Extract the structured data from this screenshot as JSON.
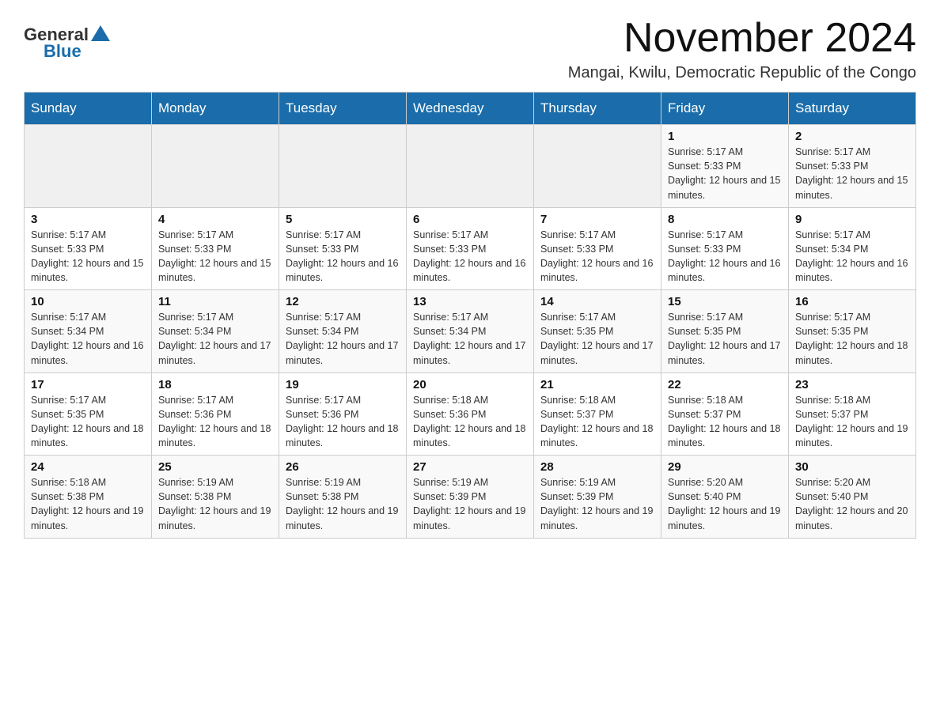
{
  "header": {
    "logo_general": "General",
    "logo_blue": "Blue",
    "title": "November 2024",
    "subtitle": "Mangai, Kwilu, Democratic Republic of the Congo"
  },
  "days_of_week": [
    "Sunday",
    "Monday",
    "Tuesday",
    "Wednesday",
    "Thursday",
    "Friday",
    "Saturday"
  ],
  "weeks": [
    [
      {
        "day": "",
        "info": ""
      },
      {
        "day": "",
        "info": ""
      },
      {
        "day": "",
        "info": ""
      },
      {
        "day": "",
        "info": ""
      },
      {
        "day": "",
        "info": ""
      },
      {
        "day": "1",
        "info": "Sunrise: 5:17 AM\nSunset: 5:33 PM\nDaylight: 12 hours and 15 minutes."
      },
      {
        "day": "2",
        "info": "Sunrise: 5:17 AM\nSunset: 5:33 PM\nDaylight: 12 hours and 15 minutes."
      }
    ],
    [
      {
        "day": "3",
        "info": "Sunrise: 5:17 AM\nSunset: 5:33 PM\nDaylight: 12 hours and 15 minutes."
      },
      {
        "day": "4",
        "info": "Sunrise: 5:17 AM\nSunset: 5:33 PM\nDaylight: 12 hours and 15 minutes."
      },
      {
        "day": "5",
        "info": "Sunrise: 5:17 AM\nSunset: 5:33 PM\nDaylight: 12 hours and 16 minutes."
      },
      {
        "day": "6",
        "info": "Sunrise: 5:17 AM\nSunset: 5:33 PM\nDaylight: 12 hours and 16 minutes."
      },
      {
        "day": "7",
        "info": "Sunrise: 5:17 AM\nSunset: 5:33 PM\nDaylight: 12 hours and 16 minutes."
      },
      {
        "day": "8",
        "info": "Sunrise: 5:17 AM\nSunset: 5:33 PM\nDaylight: 12 hours and 16 minutes."
      },
      {
        "day": "9",
        "info": "Sunrise: 5:17 AM\nSunset: 5:34 PM\nDaylight: 12 hours and 16 minutes."
      }
    ],
    [
      {
        "day": "10",
        "info": "Sunrise: 5:17 AM\nSunset: 5:34 PM\nDaylight: 12 hours and 16 minutes."
      },
      {
        "day": "11",
        "info": "Sunrise: 5:17 AM\nSunset: 5:34 PM\nDaylight: 12 hours and 17 minutes."
      },
      {
        "day": "12",
        "info": "Sunrise: 5:17 AM\nSunset: 5:34 PM\nDaylight: 12 hours and 17 minutes."
      },
      {
        "day": "13",
        "info": "Sunrise: 5:17 AM\nSunset: 5:34 PM\nDaylight: 12 hours and 17 minutes."
      },
      {
        "day": "14",
        "info": "Sunrise: 5:17 AM\nSunset: 5:35 PM\nDaylight: 12 hours and 17 minutes."
      },
      {
        "day": "15",
        "info": "Sunrise: 5:17 AM\nSunset: 5:35 PM\nDaylight: 12 hours and 17 minutes."
      },
      {
        "day": "16",
        "info": "Sunrise: 5:17 AM\nSunset: 5:35 PM\nDaylight: 12 hours and 18 minutes."
      }
    ],
    [
      {
        "day": "17",
        "info": "Sunrise: 5:17 AM\nSunset: 5:35 PM\nDaylight: 12 hours and 18 minutes."
      },
      {
        "day": "18",
        "info": "Sunrise: 5:17 AM\nSunset: 5:36 PM\nDaylight: 12 hours and 18 minutes."
      },
      {
        "day": "19",
        "info": "Sunrise: 5:17 AM\nSunset: 5:36 PM\nDaylight: 12 hours and 18 minutes."
      },
      {
        "day": "20",
        "info": "Sunrise: 5:18 AM\nSunset: 5:36 PM\nDaylight: 12 hours and 18 minutes."
      },
      {
        "day": "21",
        "info": "Sunrise: 5:18 AM\nSunset: 5:37 PM\nDaylight: 12 hours and 18 minutes."
      },
      {
        "day": "22",
        "info": "Sunrise: 5:18 AM\nSunset: 5:37 PM\nDaylight: 12 hours and 18 minutes."
      },
      {
        "day": "23",
        "info": "Sunrise: 5:18 AM\nSunset: 5:37 PM\nDaylight: 12 hours and 19 minutes."
      }
    ],
    [
      {
        "day": "24",
        "info": "Sunrise: 5:18 AM\nSunset: 5:38 PM\nDaylight: 12 hours and 19 minutes."
      },
      {
        "day": "25",
        "info": "Sunrise: 5:19 AM\nSunset: 5:38 PM\nDaylight: 12 hours and 19 minutes."
      },
      {
        "day": "26",
        "info": "Sunrise: 5:19 AM\nSunset: 5:38 PM\nDaylight: 12 hours and 19 minutes."
      },
      {
        "day": "27",
        "info": "Sunrise: 5:19 AM\nSunset: 5:39 PM\nDaylight: 12 hours and 19 minutes."
      },
      {
        "day": "28",
        "info": "Sunrise: 5:19 AM\nSunset: 5:39 PM\nDaylight: 12 hours and 19 minutes."
      },
      {
        "day": "29",
        "info": "Sunrise: 5:20 AM\nSunset: 5:40 PM\nDaylight: 12 hours and 19 minutes."
      },
      {
        "day": "30",
        "info": "Sunrise: 5:20 AM\nSunset: 5:40 PM\nDaylight: 12 hours and 20 minutes."
      }
    ]
  ]
}
